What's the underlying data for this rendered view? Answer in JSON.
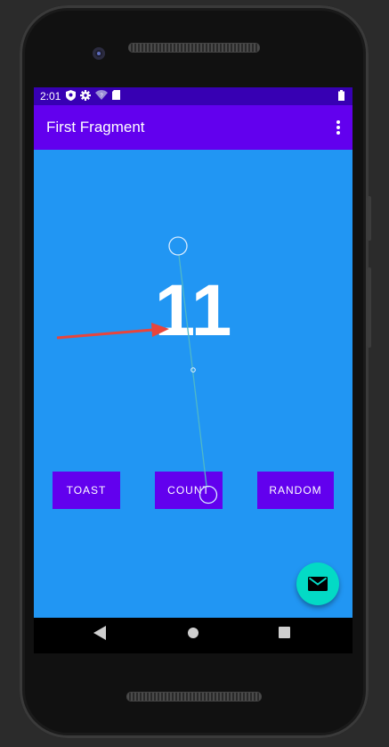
{
  "status_bar": {
    "time": "2:01",
    "icons": [
      "shield-icon",
      "gear-icon",
      "wifi-icon",
      "sd-card-icon",
      "battery-icon"
    ]
  },
  "app_bar": {
    "title": "First Fragment",
    "overflow_icon": "more-vert-icon"
  },
  "main": {
    "count_value": "11",
    "buttons": {
      "toast": "TOAST",
      "count": "COUNT",
      "random": "RANDOM"
    },
    "fab_icon": "mail-icon"
  },
  "nav_bar": {
    "icons": [
      "back-icon",
      "home-icon",
      "recents-icon"
    ]
  },
  "colors": {
    "status_bar": "#3700b3",
    "app_bar": "#6200ee",
    "content_bg": "#2196f3",
    "button": "#6200ee",
    "fab": "#03dac5",
    "annotation_arrow": "#e8453c"
  }
}
